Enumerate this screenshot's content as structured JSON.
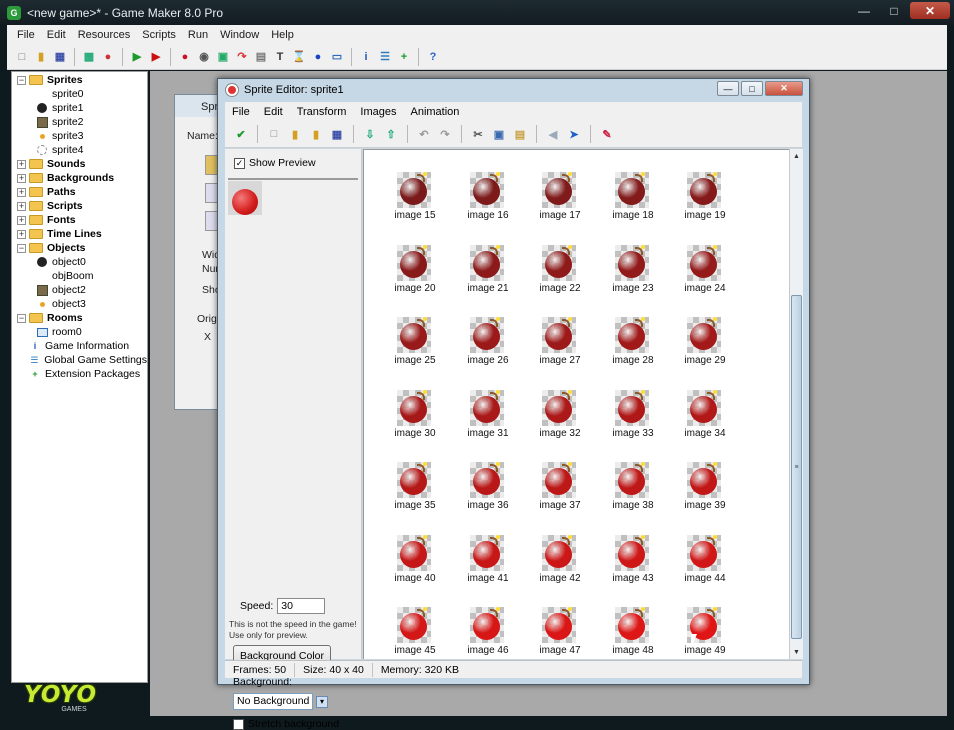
{
  "app": {
    "title": "<new game>* - Game Maker 8.0 Pro",
    "menu": [
      "File",
      "Edit",
      "Resources",
      "Scripts",
      "Run",
      "Window",
      "Help"
    ]
  },
  "tree": {
    "items": [
      {
        "label": "Sprites",
        "level": 0,
        "type": "folder",
        "expanded": true
      },
      {
        "label": "sprite0",
        "level": 1,
        "type": "sprite-empty"
      },
      {
        "label": "sprite1",
        "level": 1,
        "type": "sprite-bomb"
      },
      {
        "label": "sprite2",
        "level": 1,
        "type": "sprite-box"
      },
      {
        "label": "sprite3",
        "level": 1,
        "type": "sprite-dot"
      },
      {
        "label": "sprite4",
        "level": 1,
        "type": "sprite-dashed"
      },
      {
        "label": "Sounds",
        "level": 0,
        "type": "folder"
      },
      {
        "label": "Backgrounds",
        "level": 0,
        "type": "folder"
      },
      {
        "label": "Paths",
        "level": 0,
        "type": "folder"
      },
      {
        "label": "Scripts",
        "level": 0,
        "type": "folder"
      },
      {
        "label": "Fonts",
        "level": 0,
        "type": "folder"
      },
      {
        "label": "Time Lines",
        "level": 0,
        "type": "folder"
      },
      {
        "label": "Objects",
        "level": 0,
        "type": "folder",
        "expanded": true
      },
      {
        "label": "object0",
        "level": 1,
        "type": "sprite-bomb"
      },
      {
        "label": "objBoom",
        "level": 1,
        "type": "sprite-empty"
      },
      {
        "label": "object2",
        "level": 1,
        "type": "sprite-box"
      },
      {
        "label": "object3",
        "level": 1,
        "type": "sprite-dot"
      },
      {
        "label": "Rooms",
        "level": 0,
        "type": "folder",
        "expanded": true
      },
      {
        "label": "room0",
        "level": 1,
        "type": "room"
      },
      {
        "label": "Game Information",
        "level": 0,
        "type": "info"
      },
      {
        "label": "Global Game Settings",
        "level": 0,
        "type": "settings"
      },
      {
        "label": "Extension Packages",
        "level": 0,
        "type": "extension"
      }
    ]
  },
  "logo": {
    "text": "YOYO",
    "sub": "GAMES"
  },
  "bg_window": {
    "title": "Spri",
    "labels": [
      "Name:",
      "Wid",
      "Nur",
      "Sho",
      "Origi",
      "X"
    ]
  },
  "editor": {
    "title": "Sprite Editor: sprite1",
    "menu": [
      "File",
      "Edit",
      "Transform",
      "Images",
      "Animation"
    ],
    "show_preview": "Show Preview",
    "speed_label": "Speed:",
    "speed_value": "30",
    "speed_note": "This is not the speed in the game! Use only for preview.",
    "background_color_button": "Background Color",
    "background_label": "Background:",
    "background_value": "No Background",
    "stretch_label": "Stretch background",
    "images": [
      "image 15",
      "image 16",
      "image 17",
      "image 18",
      "image 19",
      "image 20",
      "image 21",
      "image 22",
      "image 23",
      "image 24",
      "image 25",
      "image 26",
      "image 27",
      "image 28",
      "image 29",
      "image 30",
      "image 31",
      "image 32",
      "image 33",
      "image 34",
      "image 35",
      "image 36",
      "image 37",
      "image 38",
      "image 39",
      "image 40",
      "image 41",
      "image 42",
      "image 43",
      "image 44",
      "image 45",
      "image 46",
      "image 47",
      "image 48",
      "image 49"
    ],
    "status": {
      "frames": "Frames: 50",
      "size": "Size: 40 x 40",
      "memory": "Memory: 320 KB"
    }
  },
  "colors": {
    "bomb_dark": "#7a1b1b",
    "bomb_bright": "#e01616",
    "accent": "#2a9a3a"
  }
}
